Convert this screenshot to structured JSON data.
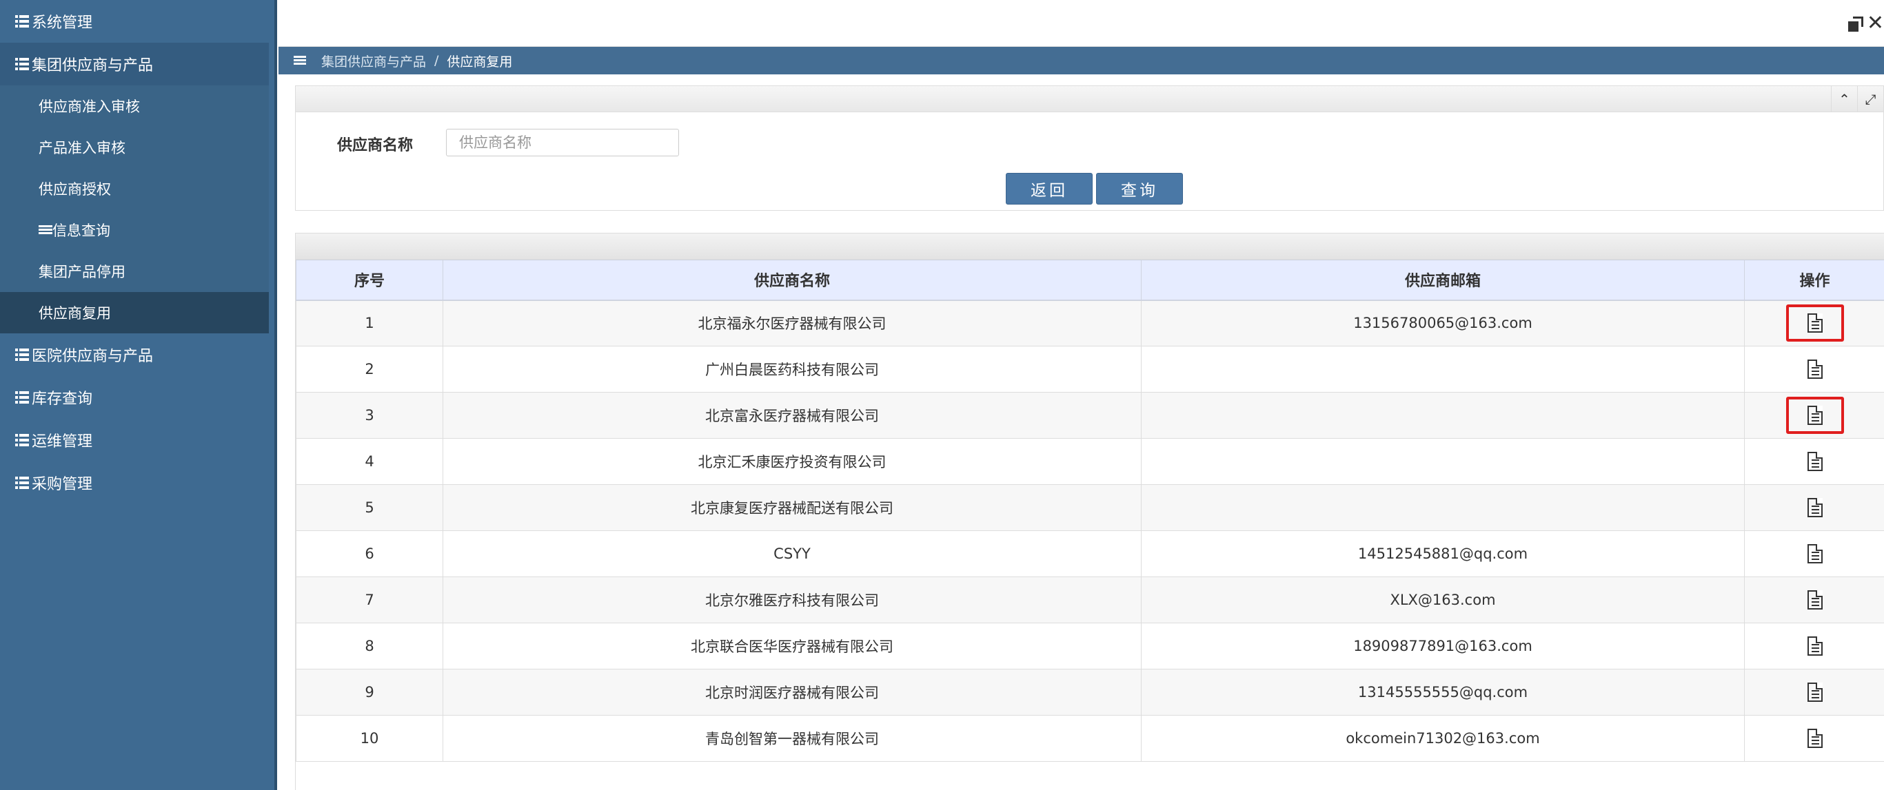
{
  "sidebar": {
    "groups": [
      {
        "label": "系统管理"
      },
      {
        "label": "集团供应商与产品"
      },
      {
        "label": "医院供应商与产品"
      },
      {
        "label": "库存查询"
      },
      {
        "label": "运维管理"
      },
      {
        "label": "采购管理"
      }
    ],
    "sub_items": [
      {
        "label": "供应商准入审核"
      },
      {
        "label": "产品准入审核"
      },
      {
        "label": "供应商授权"
      },
      {
        "label": "信息查询"
      },
      {
        "label": "集团产品停用"
      },
      {
        "label": "供应商复用"
      }
    ]
  },
  "topbar": {
    "close_glyph": "✕"
  },
  "breadcrumb": {
    "parent": "集团供应商与产品",
    "separator": "/",
    "current": "供应商复用"
  },
  "search": {
    "label": "供应商名称",
    "placeholder": "供应商名称",
    "value": "",
    "back_label": "返回",
    "query_label": "查询",
    "collapse_glyph": "⌃",
    "expand_glyph": "⤢"
  },
  "table": {
    "headers": [
      "序号",
      "供应商名称",
      "供应商邮箱",
      "操作"
    ],
    "rows": [
      {
        "index": "1",
        "name": "北京福永尔医疗器械有限公司",
        "email": "13156780065@163.com",
        "highlighted": true
      },
      {
        "index": "2",
        "name": "广州白晨医药科技有限公司",
        "email": "",
        "highlighted": false
      },
      {
        "index": "3",
        "name": "北京富永医疗器械有限公司",
        "email": "",
        "highlighted": true
      },
      {
        "index": "4",
        "name": "北京汇禾康医疗投资有限公司",
        "email": "",
        "highlighted": false
      },
      {
        "index": "5",
        "name": "北京康复医疗器械配送有限公司",
        "email": "",
        "highlighted": false
      },
      {
        "index": "6",
        "name": "CSYY",
        "email": "14512545881@qq.com",
        "highlighted": false
      },
      {
        "index": "7",
        "name": "北京尔雅医疗科技有限公司",
        "email": "XLX@163.com",
        "highlighted": false
      },
      {
        "index": "8",
        "name": "北京联合医华医疗器械有限公司",
        "email": "18909877891@163.com",
        "highlighted": false
      },
      {
        "index": "9",
        "name": "北京时润医疗器械有限公司",
        "email": "13145555555@qq.com",
        "highlighted": false
      },
      {
        "index": "10",
        "name": "青岛创智第一器械有限公司",
        "email": "okcomein71302@163.com",
        "highlighted": false
      }
    ],
    "action_icon": "document-icon"
  },
  "colors": {
    "sidebar_bg": "#3e6a91",
    "crumb_bg": "#446d93",
    "button_bg": "#4a78a6",
    "header_bg": "#e6ecff",
    "highlight": "#e01e1e"
  }
}
